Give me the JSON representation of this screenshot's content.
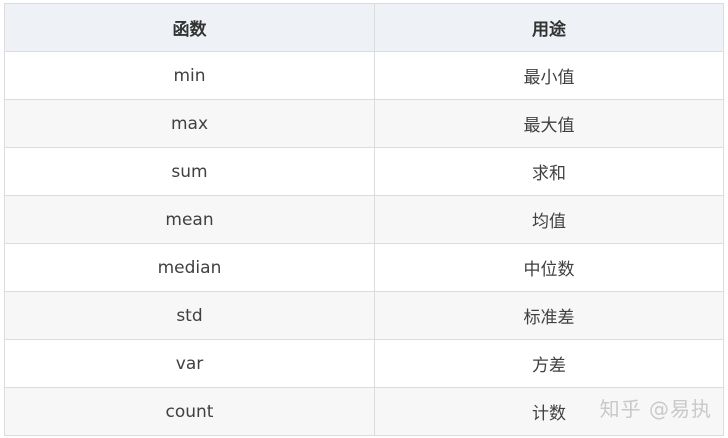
{
  "table": {
    "headers": [
      "函数",
      "用途"
    ],
    "rows": [
      [
        "min",
        "最小值"
      ],
      [
        "max",
        "最大值"
      ],
      [
        "sum",
        "求和"
      ],
      [
        "mean",
        "均值"
      ],
      [
        "median",
        "中位数"
      ],
      [
        "std",
        "标准差"
      ],
      [
        "var",
        "方差"
      ],
      [
        "count",
        "计数"
      ]
    ]
  },
  "watermark": "知乎 @易执"
}
